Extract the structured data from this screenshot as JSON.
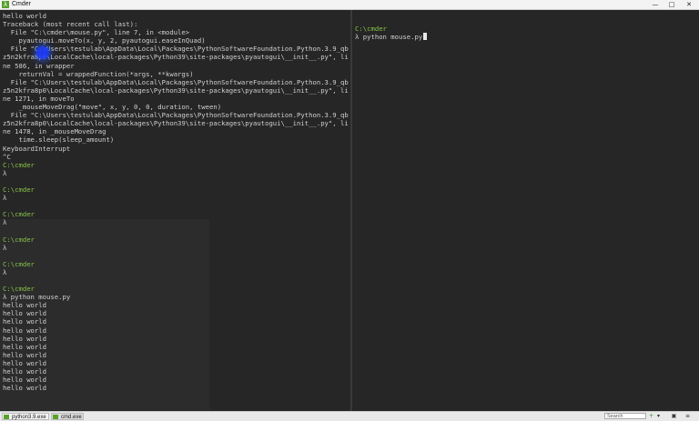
{
  "window": {
    "title": "Cmder",
    "app_icon": "λ",
    "controls": {
      "minimize": "—",
      "maximize": "□",
      "close": "✕"
    }
  },
  "left_pane": {
    "lines": [
      {
        "text": "hello world",
        "kind": "out"
      },
      {
        "text": "Traceback (most recent call last):",
        "kind": "out"
      },
      {
        "text": "  File \"C:\\cmder\\mouse.py\", line 7, in <module>",
        "kind": "out"
      },
      {
        "text": "    pyautogui.moveTo(x, y, 2, pyautogui.easeInQuad)",
        "kind": "out"
      },
      {
        "text": "  File \"C:\\Users\\testulab\\AppData\\Local\\Packages\\PythonSoftwareFoundation.Python.3.9_qb",
        "kind": "out"
      },
      {
        "text": "z5n2kfra8p0\\LocalCache\\local-packages\\Python39\\site-packages\\pyautogui\\__init__.py\", li",
        "kind": "out"
      },
      {
        "text": "ne 586, in wrapper",
        "kind": "out"
      },
      {
        "text": "    returnVal = wrappedFunction(*args, **kwargs)",
        "kind": "out"
      },
      {
        "text": "  File \"C:\\Users\\testulab\\AppData\\Local\\Packages\\PythonSoftwareFoundation.Python.3.9_qb",
        "kind": "out"
      },
      {
        "text": "z5n2kfra8p0\\LocalCache\\local-packages\\Python39\\site-packages\\pyautogui\\__init__.py\", li",
        "kind": "out"
      },
      {
        "text": "ne 1271, in moveTo",
        "kind": "out"
      },
      {
        "text": "    _mouseMoveDrag(\"move\", x, y, 0, 0, duration, tween)",
        "kind": "out"
      },
      {
        "text": "  File \"C:\\Users\\testulab\\AppData\\Local\\Packages\\PythonSoftwareFoundation.Python.3.9_qb",
        "kind": "out"
      },
      {
        "text": "z5n2kfra8p0\\LocalCache\\local-packages\\Python39\\site-packages\\pyautogui\\__init__.py\", li",
        "kind": "out"
      },
      {
        "text": "ne 1478, in _mouseMoveDrag",
        "kind": "out"
      },
      {
        "text": "    time.sleep(sleep_amount)",
        "kind": "out"
      },
      {
        "text": "KeyboardInterrupt",
        "kind": "out"
      },
      {
        "text": "^C",
        "kind": "out"
      },
      {
        "text": "C:\\cmder",
        "kind": "prompt"
      },
      {
        "text": "λ",
        "kind": "out"
      },
      {
        "text": "",
        "kind": "out"
      },
      {
        "text": "C:\\cmder",
        "kind": "prompt"
      },
      {
        "text": "λ",
        "kind": "out"
      },
      {
        "text": "",
        "kind": "out"
      },
      {
        "text": "C:\\cmder",
        "kind": "prompt"
      },
      {
        "text": "λ",
        "kind": "out"
      },
      {
        "text": "",
        "kind": "out"
      },
      {
        "text": "C:\\cmder",
        "kind": "prompt"
      },
      {
        "text": "λ",
        "kind": "out"
      },
      {
        "text": "",
        "kind": "out"
      },
      {
        "text": "C:\\cmder",
        "kind": "prompt"
      },
      {
        "text": "λ",
        "kind": "out"
      },
      {
        "text": "",
        "kind": "out"
      },
      {
        "text": "C:\\cmder",
        "kind": "prompt"
      },
      {
        "text": "λ python mouse.py",
        "kind": "out"
      },
      {
        "text": "hello world",
        "kind": "out"
      },
      {
        "text": "hello world",
        "kind": "out"
      },
      {
        "text": "hello world",
        "kind": "out"
      },
      {
        "text": "hello world",
        "kind": "out"
      },
      {
        "text": "hello world",
        "kind": "out"
      },
      {
        "text": "hello world",
        "kind": "out"
      },
      {
        "text": "hello world",
        "kind": "out"
      },
      {
        "text": "hello world",
        "kind": "out"
      },
      {
        "text": "hello world",
        "kind": "out"
      },
      {
        "text": "hello world",
        "kind": "out"
      },
      {
        "text": "hello world",
        "kind": "out"
      }
    ]
  },
  "right_pane": {
    "prompt": "C:\\cmder",
    "command": "λ python mouse.py"
  },
  "statusbar": {
    "tabs": [
      {
        "label": "python3.9.exe"
      },
      {
        "label": "cmd.exe"
      }
    ],
    "search_placeholder": "Search",
    "buttons": {
      "add": "+",
      "dropdown": "▾",
      "lock": "▣",
      "menu": "≡"
    }
  },
  "colors": {
    "prompt": "#85c446",
    "text": "#d0d0d0",
    "background": "#262626",
    "cursor_highlight": "#1e3cff"
  }
}
